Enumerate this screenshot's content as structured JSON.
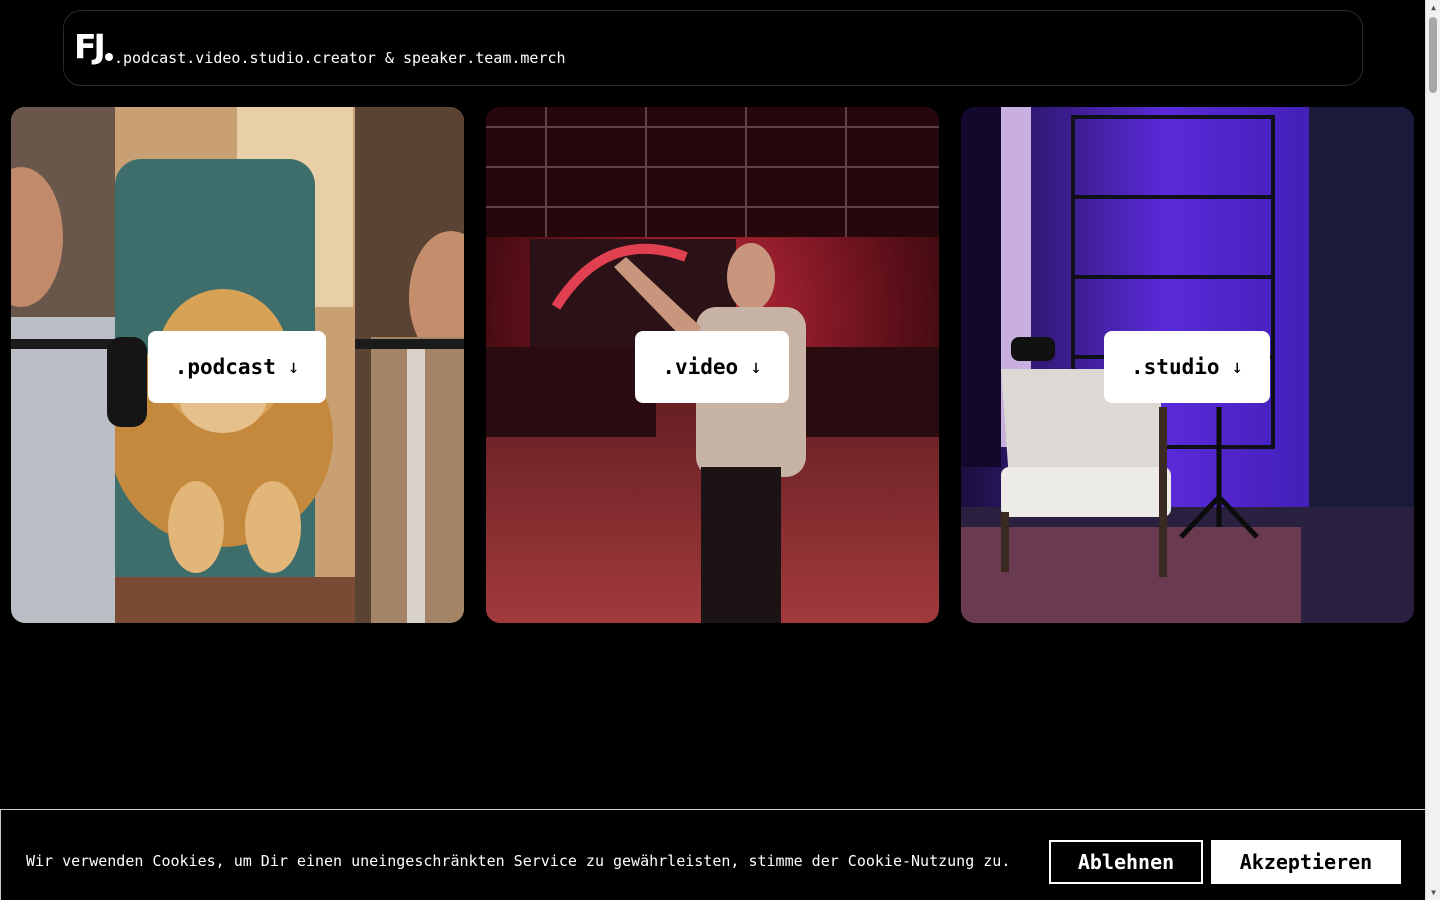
{
  "header": {
    "logo_text": "FJ",
    "nav": [
      {
        "label": ".podcast"
      },
      {
        "label": ".video"
      },
      {
        "label": ".studio"
      },
      {
        "label": ".creator & speaker"
      },
      {
        "label": ".team"
      },
      {
        "label": ".merch"
      }
    ]
  },
  "cards": [
    {
      "label": ".podcast",
      "arrow": "↓",
      "image": "podcast-hosts-with-golden-retriever"
    },
    {
      "label": ".video",
      "arrow": "↓",
      "image": "event-hall-speaker-red-light"
    },
    {
      "label": ".studio",
      "arrow": "↓",
      "image": "studio-chair-purple-light"
    }
  ],
  "cookie_banner": {
    "text": "Wir verwenden Cookies, um Dir einen uneingeschränkten Service zu gewährleisten, stimme der Cookie-Nutzung zu.",
    "decline_label": "Ablehnen",
    "accept_label": "Akzeptieren"
  },
  "colors": {
    "background": "#000000",
    "button_bg": "#ffffff",
    "button_text": "#000000"
  }
}
